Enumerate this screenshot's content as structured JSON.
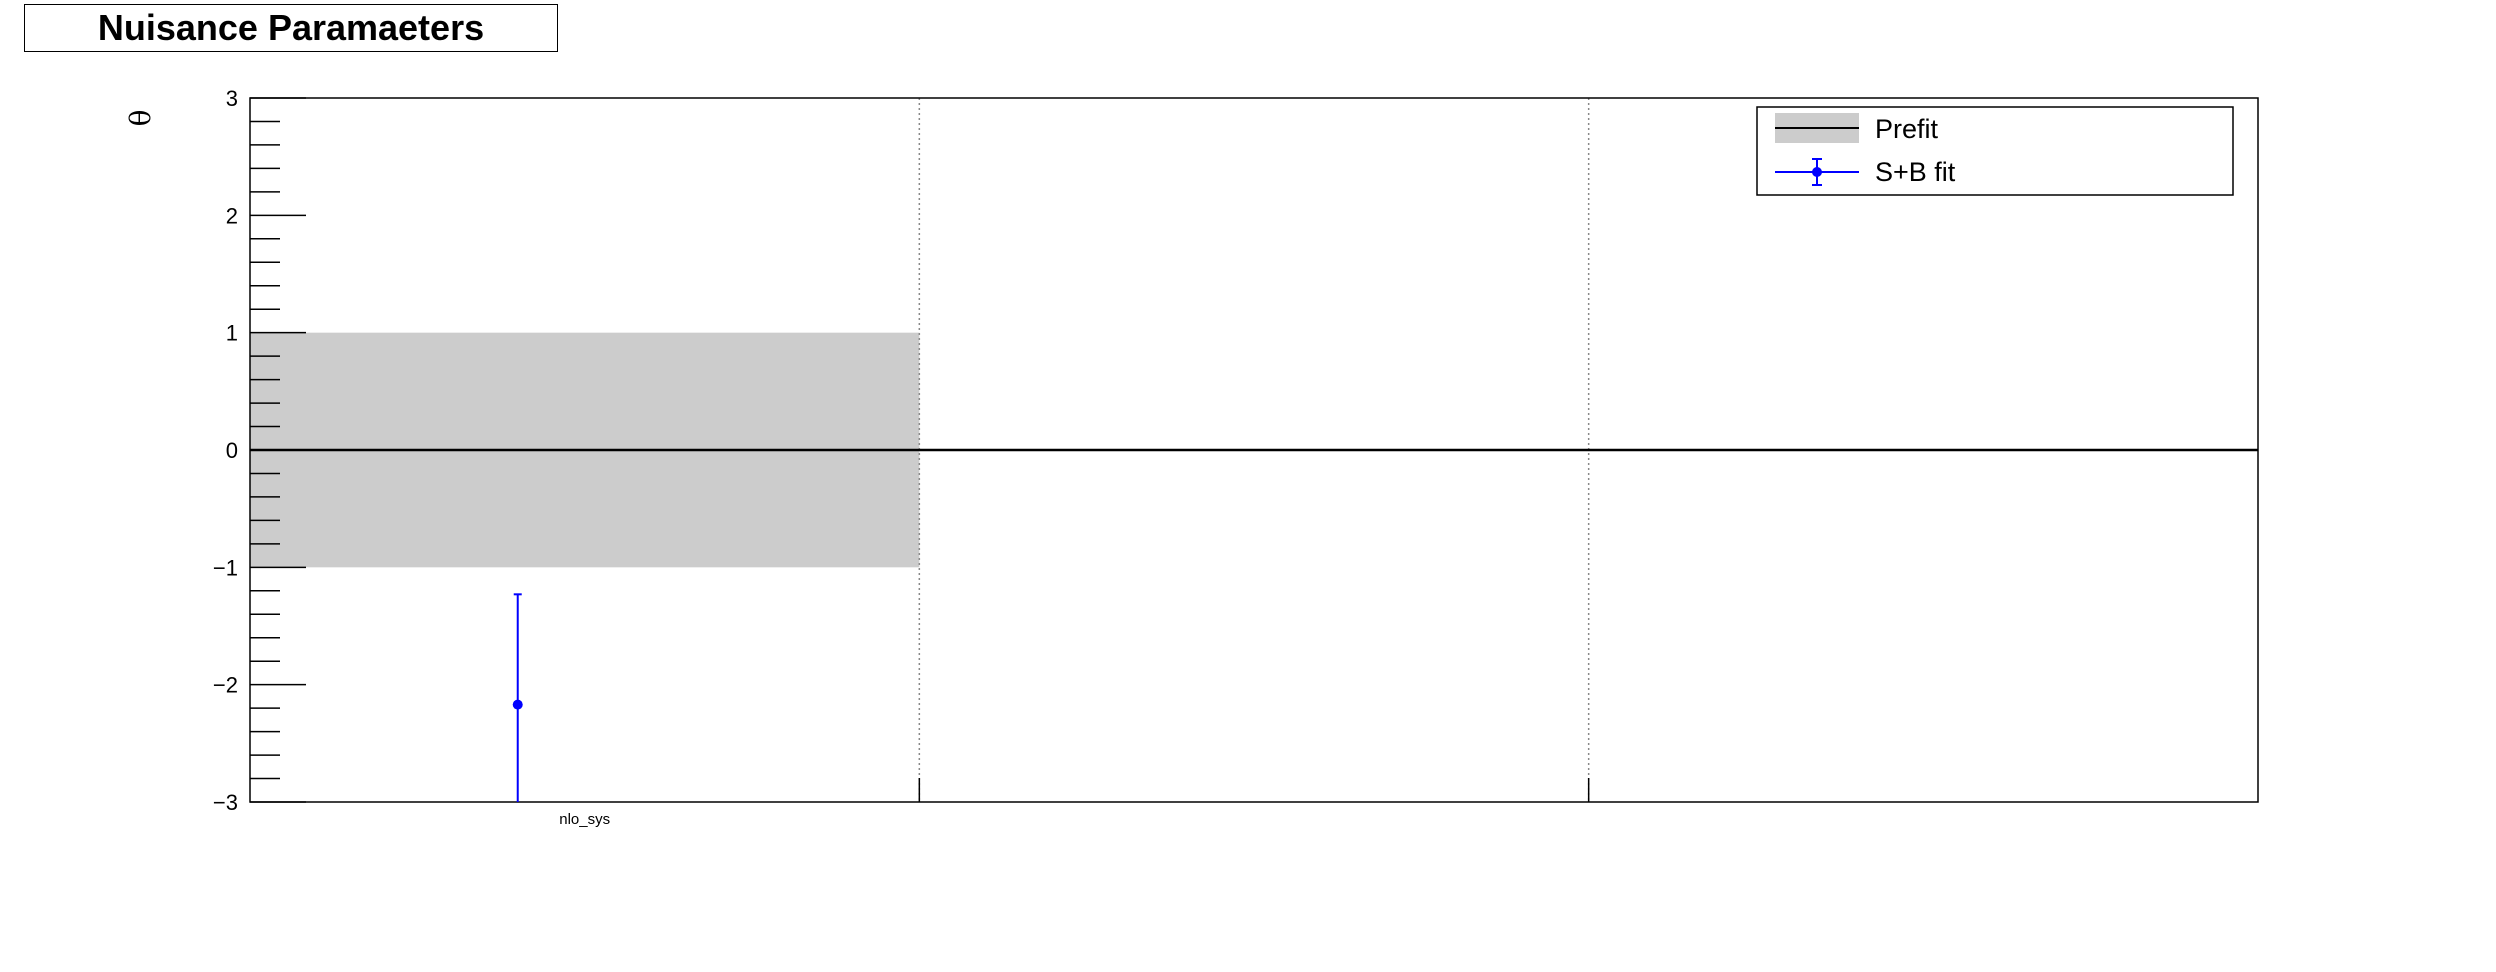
{
  "chart_data": {
    "type": "scatter",
    "title": "Nuisance Paramaeters",
    "ylabel": "θ",
    "xlabel": "",
    "ylim": [
      -3,
      3
    ],
    "yticks_major": [
      -3,
      -2,
      -1,
      0,
      1,
      2,
      3
    ],
    "ytick_labels": [
      "−3",
      "−2",
      "−1",
      "0",
      "1",
      "2",
      "3"
    ],
    "categories": [
      "nlo_sys",
      "",
      ""
    ],
    "series": [
      {
        "name": "Prefit",
        "kind": "band",
        "color": "#cccccc",
        "line_color": "#000000",
        "values": [
          {
            "category": 0,
            "center": 0,
            "low": -1,
            "high": 1
          }
        ]
      },
      {
        "name": "S+B fit",
        "kind": "points",
        "color": "#0000ff",
        "values": [
          {
            "category": 0,
            "y": -2.17,
            "err_low": 0.83,
            "err_high": 0.94
          }
        ]
      }
    ],
    "legend": {
      "position": "top-right"
    },
    "grid": {
      "x": true,
      "y": false
    }
  }
}
